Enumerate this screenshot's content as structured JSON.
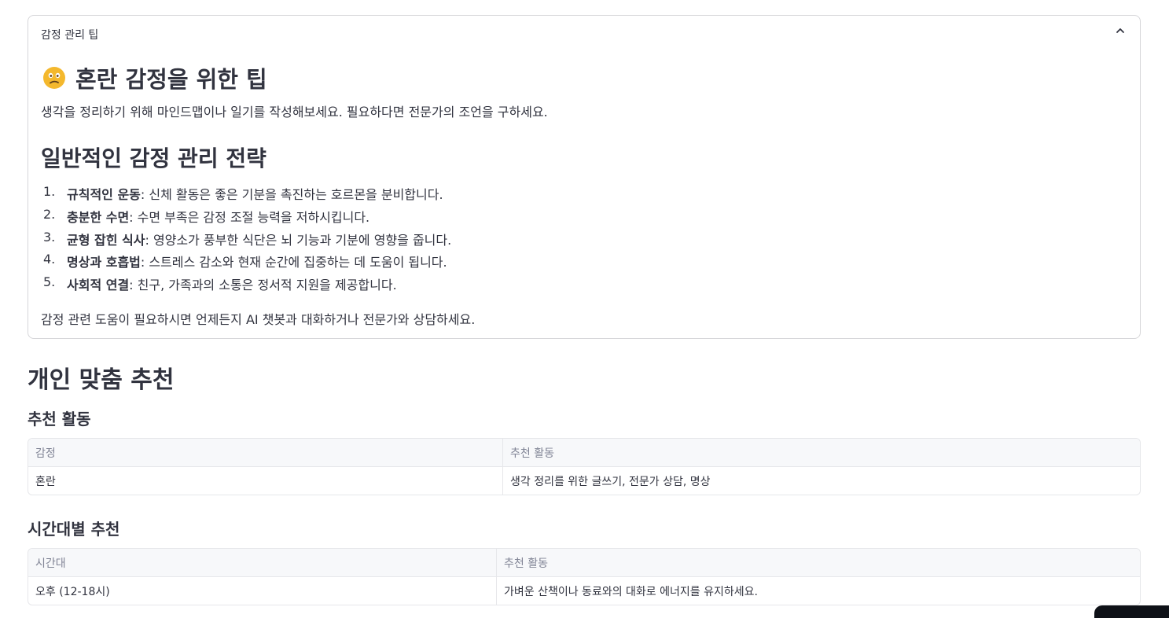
{
  "expander": {
    "header": "감정 관리 팁",
    "tip_title": "혼란 감정을 위한 팁",
    "tip_text": "생각을 정리하기 위해 마인드맵이나 일기를 작성해보세요. 필요하다면 전문가의 조언을 구하세요.",
    "strategies_title": "일반적인 감정 관리 전략",
    "strategies": [
      {
        "num": "1.",
        "bold": "규칙적인 운동",
        "text": ": 신체 활동은 좋은 기분을 촉진하는 호르몬을 분비합니다."
      },
      {
        "num": "2.",
        "bold": "충분한 수면",
        "text": ": 수면 부족은 감정 조절 능력을 저하시킵니다."
      },
      {
        "num": "3.",
        "bold": "균형 잡힌 식사",
        "text": ": 영양소가 풍부한 식단은 뇌 기능과 기분에 영향을 줍니다."
      },
      {
        "num": "4.",
        "bold": "명상과 호흡법",
        "text": ": 스트레스 감소와 현재 순간에 집중하는 데 도움이 됩니다."
      },
      {
        "num": "5.",
        "bold": "사회적 연결",
        "text": ": 친구, 가족과의 소통은 정서적 지원을 제공합니다."
      }
    ],
    "closing": "감정 관련 도움이 필요하시면 언제든지 AI 챗봇과 대화하거나 전문가와 상담하세요."
  },
  "personal": {
    "title": "개인 맞춤 추천",
    "activities_title": "추천 활동",
    "activities_table": {
      "columns": [
        "감정",
        "추천 활동"
      ],
      "rows": [
        [
          "혼란",
          "생각 정리를 위한 글쓰기, 전문가 상담, 명상"
        ]
      ]
    },
    "time_title": "시간대별 추천",
    "time_table": {
      "columns": [
        "시간대",
        "추천 활동"
      ],
      "rows": [
        [
          "오후 (12-18시)",
          "가벼운 산책이나 동료와의 대화로 에너지를 유지하세요."
        ]
      ]
    }
  },
  "icons": {
    "expander_toggle": "chevron-up-icon",
    "tip_emoji": "confused-face-icon"
  },
  "colors": {
    "text": "#31333f",
    "muted": "#808495",
    "border": "#d6d6d9",
    "emoji": "#f4b82d"
  }
}
